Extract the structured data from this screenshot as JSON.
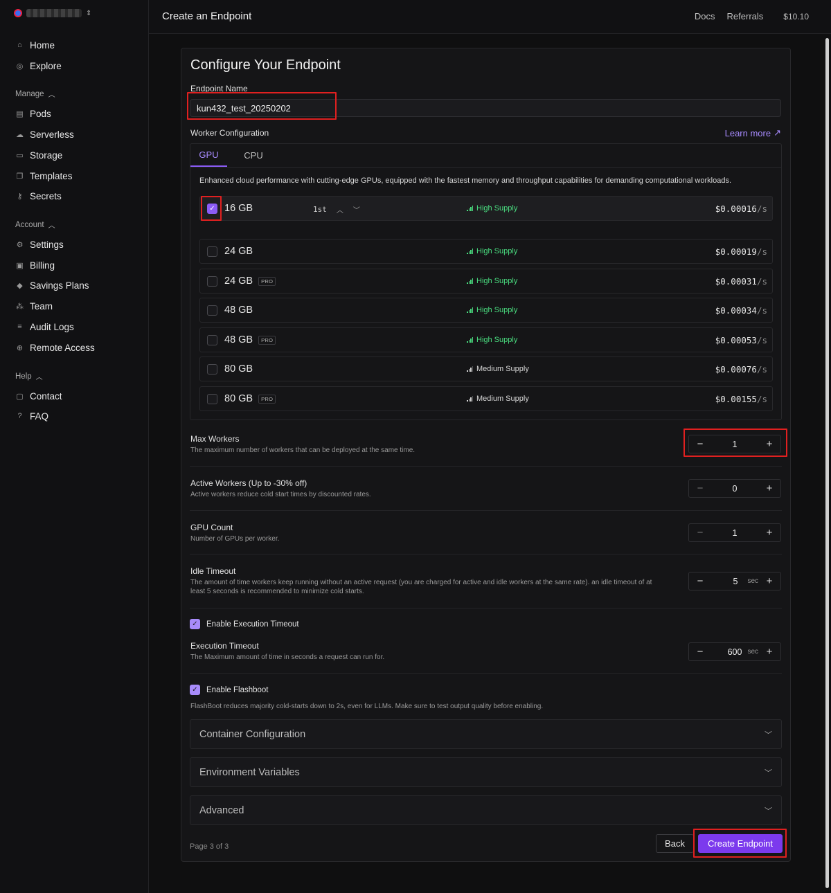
{
  "sidebar": {
    "items": {
      "home": "Home",
      "explore": "Explore",
      "pods": "Pods",
      "serverless": "Serverless",
      "storage": "Storage",
      "templates": "Templates",
      "secrets": "Secrets",
      "settings": "Settings",
      "billing": "Billing",
      "savings_plans": "Savings Plans",
      "team": "Team",
      "audit_logs": "Audit Logs",
      "remote_access": "Remote Access",
      "contact": "Contact",
      "faq": "FAQ"
    },
    "sections": {
      "manage": "Manage",
      "account": "Account",
      "help": "Help"
    }
  },
  "topbar": {
    "title": "Create an Endpoint",
    "docs": "Docs",
    "referrals": "Referrals",
    "balance": "$10.10"
  },
  "form": {
    "heading": "Configure Your Endpoint",
    "endpoint_name_label": "Endpoint Name",
    "endpoint_name_value": "kun432_test_20250202",
    "worker_config_label": "Worker Configuration",
    "learn_more": "Learn more",
    "tabs": [
      "GPU",
      "CPU"
    ],
    "gpu_description": "Enhanced cloud performance with cutting-edge GPUs, equipped with the fastest memory and throughput capabilities for demanding computational workloads.",
    "gpu_options": [
      {
        "size": "16 GB",
        "pro": "",
        "supply": "High Supply",
        "price": "$0.00016",
        "unit": "/s",
        "checked": true,
        "rank": "1st"
      },
      {
        "size": "24 GB",
        "pro": "",
        "supply": "High Supply",
        "price": "$0.00019",
        "unit": "/s",
        "checked": false
      },
      {
        "size": "24 GB",
        "pro": "PRO",
        "supply": "High Supply",
        "price": "$0.00031",
        "unit": "/s",
        "checked": false
      },
      {
        "size": "48 GB",
        "pro": "",
        "supply": "High Supply",
        "price": "$0.00034",
        "unit": "/s",
        "checked": false
      },
      {
        "size": "48 GB",
        "pro": "PRO",
        "supply": "High Supply",
        "price": "$0.00053",
        "unit": "/s",
        "checked": false
      },
      {
        "size": "80 GB",
        "pro": "",
        "supply": "Medium Supply",
        "price": "$0.00076",
        "unit": "/s",
        "checked": false
      },
      {
        "size": "80 GB",
        "pro": "PRO",
        "supply": "Medium Supply",
        "price": "$0.00155",
        "unit": "/s",
        "checked": false
      }
    ],
    "max_workers": {
      "label": "Max Workers",
      "desc": "The maximum number of workers that can be deployed at the same time.",
      "value": "1"
    },
    "active_workers": {
      "label": "Active Workers (Up to -30% off)",
      "desc": "Active workers reduce cold start times by discounted rates.",
      "value": "0"
    },
    "gpu_count": {
      "label": "GPU Count",
      "desc": "Number of GPUs per worker.",
      "value": "1"
    },
    "idle_timeout": {
      "label": "Idle Timeout",
      "desc": "The amount of time workers keep running without an active request (you are charged for active and idle workers at the same rate). an idle timeout of at least 5 seconds is recommended to minimize cold starts.",
      "value": "5",
      "unit": "sec"
    },
    "enable_execution_timeout": "Enable Execution Timeout",
    "execution_timeout": {
      "label": "Execution Timeout",
      "desc": "The Maximum amount of time in seconds a request can run for.",
      "value": "600",
      "unit": "sec"
    },
    "enable_flashboot": "Enable Flashboot",
    "flashboot_desc": "FlashBoot reduces majority cold-starts down to 2s, even for LLMs. Make sure to test output quality before enabling.",
    "accordions": [
      "Container Configuration",
      "Environment Variables",
      "Advanced"
    ],
    "page_indicator": "Page 3 of 3",
    "back": "Back",
    "create": "Create Endpoint"
  },
  "colors": {
    "accent": "#8b5cf6",
    "high_supply": "#4ade80",
    "annotation": "#e02020"
  }
}
